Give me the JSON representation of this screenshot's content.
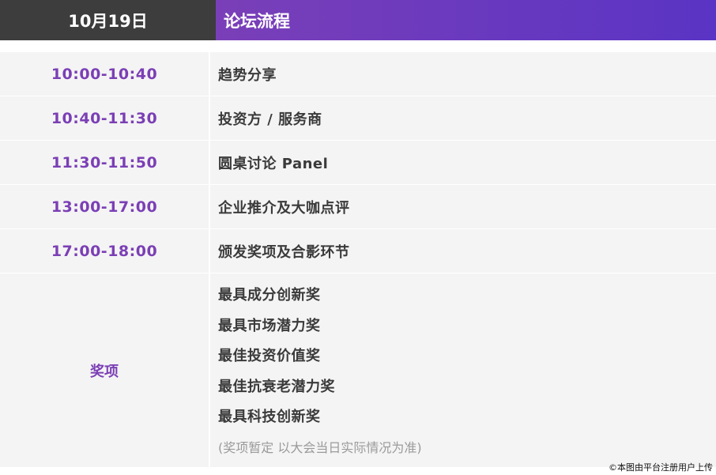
{
  "header": {
    "date": "10月19日",
    "title": "论坛流程"
  },
  "schedule": [
    {
      "time": "10:00-10:40",
      "item": "趋势分享"
    },
    {
      "time": "10:40-11:30",
      "item": "投资方 / 服务商"
    },
    {
      "time": "11:30-11:50",
      "item": "圆桌讨论 Panel"
    },
    {
      "time": "13:00-17:00",
      "item": "企业推介及大咖点评"
    },
    {
      "time": "17:00-18:00",
      "item": "颁发奖项及合影环节"
    }
  ],
  "awards": {
    "label": "奖项",
    "items": [
      "最具成分创新奖",
      "最具市场潜力奖",
      "最佳投资价值奖",
      "最佳抗衰老潜力奖",
      "最具科技创新奖"
    ],
    "note": "(奖项暂定 以大会当日实际情况为准)"
  },
  "watermark": "©本图由平台注册用户上传",
  "colors": {
    "accent": "#7b3fb5",
    "header_dark": "#3d3d3d",
    "gradient_start": "#7a3fb8",
    "gradient_end": "#5a34c4",
    "row_bg": "#f4f4f4"
  }
}
